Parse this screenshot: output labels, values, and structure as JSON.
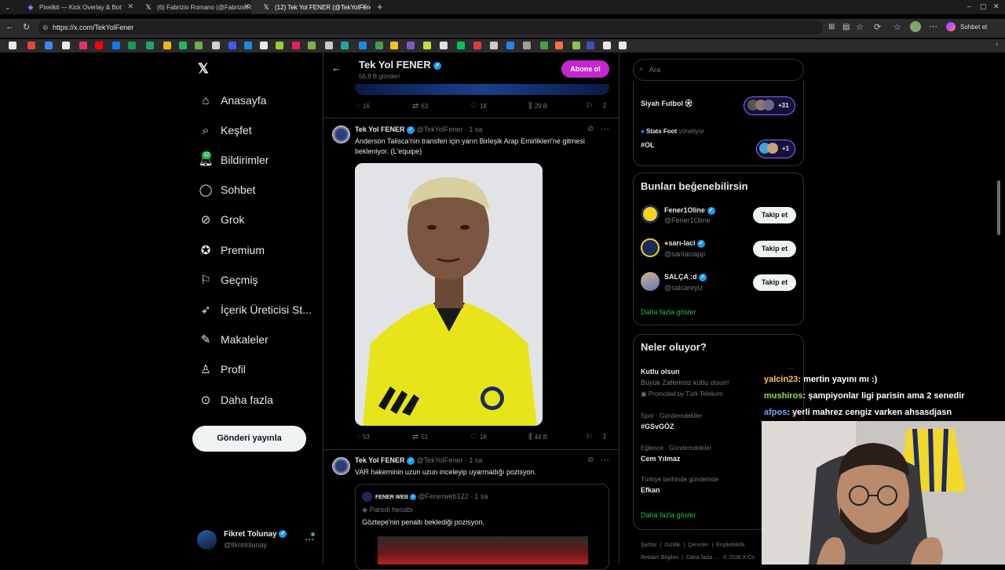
{
  "browser": {
    "tabs": [
      {
        "label": "Pixelkit — Kick Overlay & Bot"
      },
      {
        "label": "(6) Fabrizio Romano (@FabrizioRo"
      },
      {
        "label": "(12) Tek Yol FENER (@TekYolFener"
      }
    ],
    "url": "https://x.com/TekYolFener",
    "profile_button": "Sohbet et"
  },
  "sidebar": {
    "items": [
      {
        "label": "Anasayfa",
        "icon": "home-icon"
      },
      {
        "label": "Keşfet",
        "icon": "search-icon"
      },
      {
        "label": "Bildirimler",
        "icon": "bell-icon",
        "badge": "12"
      },
      {
        "label": "Sohbet",
        "icon": "chat-icon"
      },
      {
        "label": "Grok",
        "icon": "grok-icon"
      },
      {
        "label": "Premium",
        "icon": "premium-icon"
      },
      {
        "label": "Geçmiş",
        "icon": "bookmark-icon"
      },
      {
        "label": "İçerik Üreticisi St...",
        "icon": "rocket-icon"
      },
      {
        "label": "Makaleler",
        "icon": "article-icon"
      },
      {
        "label": "Profil",
        "icon": "person-icon"
      },
      {
        "label": "Daha fazla",
        "icon": "more-circle-icon"
      }
    ],
    "post_button": "Gönderi yayınla",
    "account": {
      "name": "Fikret Tolunay",
      "handle": "@fikretolunay"
    }
  },
  "header": {
    "title": "Tek Yol FENER",
    "subtitle": "56,8 B gönderi",
    "subscribe": "Abone ol"
  },
  "posts": [
    {
      "stats": {
        "replies": "16",
        "reposts": "63",
        "likes": "18",
        "views": "29 B"
      }
    },
    {
      "name": "Tek Yol FENER",
      "handle": "@TekYolFener",
      "time": "· 1 sa",
      "text": "Anderson Talisca'nın transferi için yarın Birleşik Arap Emirlikleri'ne gitmesi bekleniyor. (L'equipe)",
      "stats": {
        "replies": "53",
        "reposts": "51",
        "likes": "18",
        "views": "44 B"
      }
    },
    {
      "name": "Tek Yol FENER",
      "handle": "@TekYolFener",
      "time": "· 1 sa",
      "text": "VAR hakeminin uzun uzun inceleyip uyarmadığı pozisyon.",
      "quote": {
        "name": "FENER WEB",
        "handle": "@Fenerweb122",
        "time": "· 1 sa",
        "parody": "Parodi hesabı",
        "text": "Göztepe'nin penaltı beklediği pozisyon."
      }
    }
  ],
  "right": {
    "search_placeholder": "Ara",
    "communities": [
      {
        "name": "Siyah Futbol",
        "count": "+31"
      },
      {
        "name": "#OL",
        "manager": "Stats Foot",
        "manager_suffix": "yönetiyor",
        "count": "+1"
      }
    ],
    "who_to_follow": {
      "title": "Bunları beğenebilirsin",
      "accounts": [
        {
          "name": "Fener1Oline",
          "handle": "@Fener1Oline",
          "button": "Takip et"
        },
        {
          "name": "sarı-laci",
          "handle": "@sarilaciapp",
          "button": "Takip et"
        },
        {
          "name": "SALÇA :d",
          "handle": "@salcareyiz",
          "button": "Takip et"
        }
      ],
      "more": "Daha fazla göster"
    },
    "trends": {
      "title": "Neler oluyor?",
      "items": [
        {
          "title": "Kutlu olsun",
          "sub": "Büyük Zaferimiz kutlu olsun!",
          "promo": "Promoted by Türk Telekom"
        },
        {
          "context": "Spor · Gündemdekiler",
          "title": "#GSvGÖZ"
        },
        {
          "context": "Eğlence · Gündemdekiler",
          "title": "Cem Yılmaz"
        },
        {
          "context": "Türkiye tarihinde gündemde",
          "title": "Efkan"
        }
      ],
      "more": "Daha fazla göster"
    },
    "footer": [
      "Şartlar",
      "Gizlilik",
      "Çerezler",
      "Erişilebilirlik",
      "Reklam Bilgileri",
      "Daha fazla ...",
      "© 2026 X Co"
    ]
  },
  "chat": [
    {
      "user": "yalcin23",
      "color": "#f7c948",
      "message": ": mertin yayını mı :)"
    },
    {
      "user": "mushiros",
      "color": "#8fe04a",
      "message": ": şampiyonlar ligi parisin ama 2 senedir"
    },
    {
      "user": "afpos",
      "color": "#6fa8ff",
      "message": ": yerli mahrez cengiz varken ahsasdjasn"
    }
  ],
  "colors": {
    "accent": "#1d9bf0",
    "subscribe": "#c427cf",
    "link": "#1fbf55"
  }
}
